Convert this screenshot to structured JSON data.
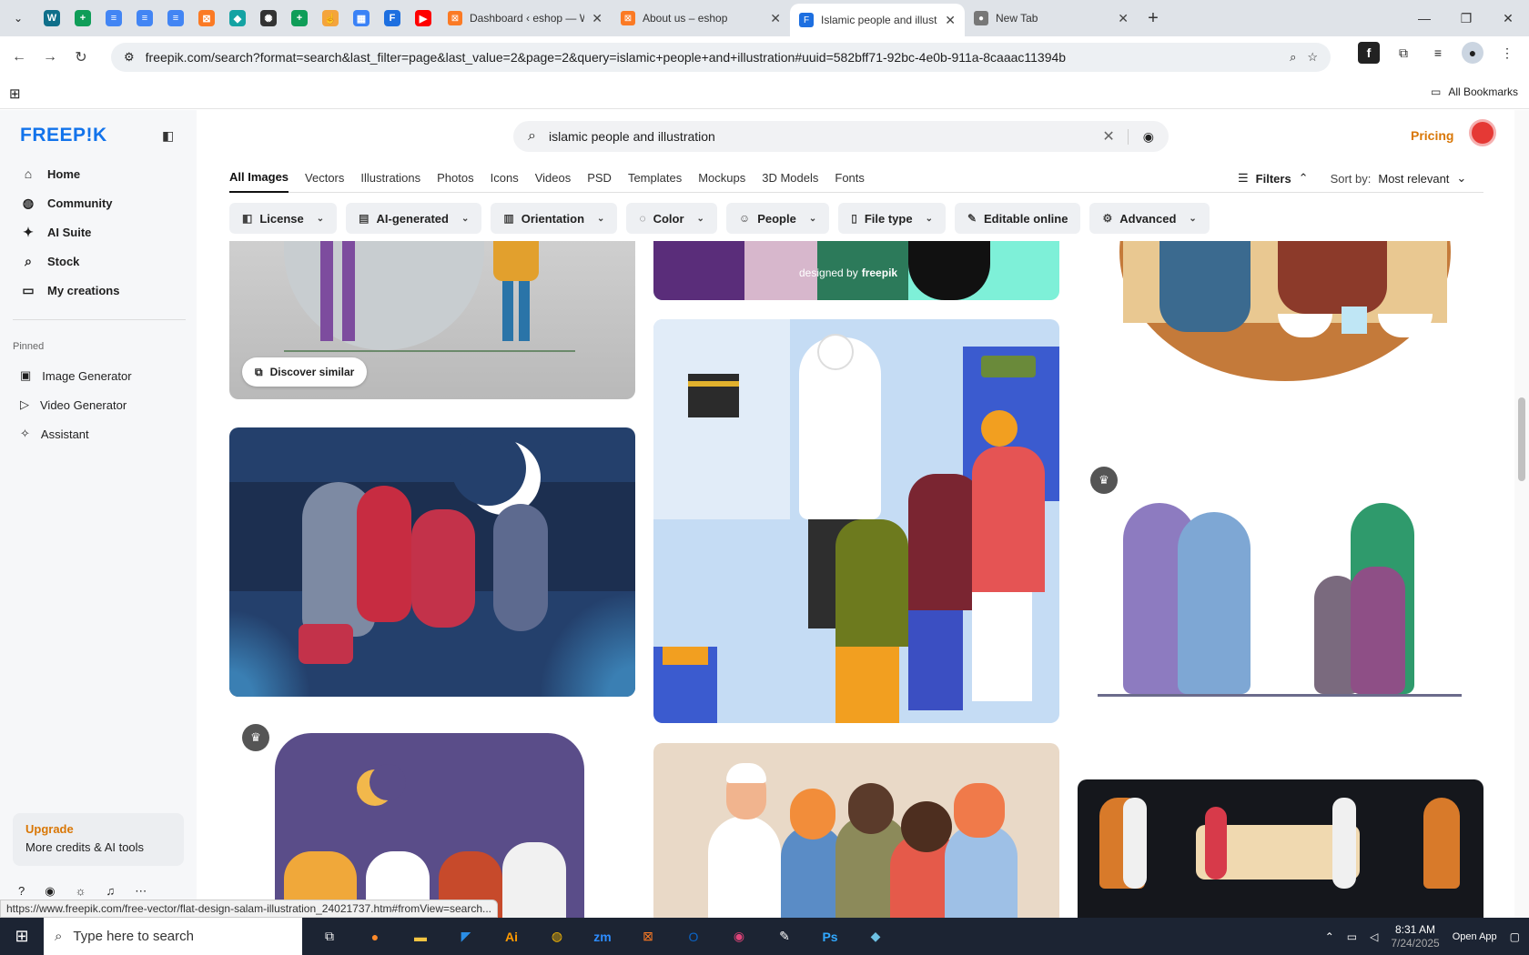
{
  "browser": {
    "pinned_tabs": [
      {
        "name": "wordpress-icon",
        "color": "#0f6f8a",
        "glyph": "W"
      },
      {
        "name": "sheets-icon",
        "color": "#0f9d58",
        "glyph": "+"
      },
      {
        "name": "docs-icon",
        "color": "#4285f4",
        "glyph": "≡"
      },
      {
        "name": "docs-icon",
        "color": "#4285f4",
        "glyph": "≡"
      },
      {
        "name": "docs-icon",
        "color": "#4285f4",
        "glyph": "≡"
      },
      {
        "name": "xampp-icon",
        "color": "#fb7a24",
        "glyph": "⊠"
      },
      {
        "name": "app-icon",
        "color": "#14a3a3",
        "glyph": "◆"
      },
      {
        "name": "chatgpt-icon",
        "color": "#333333",
        "glyph": "✺"
      },
      {
        "name": "sheets-icon",
        "color": "#0f9d58",
        "glyph": "+"
      },
      {
        "name": "hand-icon",
        "color": "#f4a43c",
        "glyph": "☝"
      },
      {
        "name": "qr-icon",
        "color": "#3b82f6",
        "glyph": "▦"
      },
      {
        "name": "forms-icon",
        "color": "#1d6fe0",
        "glyph": "F"
      },
      {
        "name": "youtube-icon",
        "color": "#ff0000",
        "glyph": "▶"
      }
    ],
    "tabs": [
      {
        "title": "Dashboard ‹ eshop — Wo",
        "color": "#fb7a24",
        "glyph": "⊠",
        "active": false
      },
      {
        "title": "About us – eshop",
        "color": "#fb7a24",
        "glyph": "⊠",
        "active": false
      },
      {
        "title": "Islamic people and illustr",
        "color": "#1d6fe0",
        "glyph": "F",
        "active": true
      },
      {
        "title": "New Tab",
        "color": "#777777",
        "glyph": "●",
        "active": false
      }
    ],
    "url": "freepik.com/search?format=search&last_filter=page&last_value=2&page=2&query=islamic+people+and+illustration#uuid=582bff71-92bc-4e0b-911a-8caaac11394b",
    "all_bookmarks": "All Bookmarks",
    "status_url": "https://www.freepik.com/free-vector/flat-design-salam-illustration_24021737.htm#fromView=search..."
  },
  "sidebar": {
    "logo": "FREEP!K",
    "nav": [
      {
        "label": "Home",
        "icon": "home-icon",
        "glyph": "⌂"
      },
      {
        "label": "Community",
        "icon": "globe-icon",
        "glyph": "◍"
      },
      {
        "label": "AI Suite",
        "icon": "sparkle-icon",
        "glyph": "✦"
      },
      {
        "label": "Stock",
        "icon": "search-icon",
        "glyph": "⌕"
      },
      {
        "label": "My creations",
        "icon": "folder-icon",
        "glyph": "▭"
      }
    ],
    "pinned_label": "Pinned",
    "pinned": [
      {
        "label": "Image Generator",
        "icon": "image-icon",
        "glyph": "▣"
      },
      {
        "label": "Video Generator",
        "icon": "video-icon",
        "glyph": "▷"
      },
      {
        "label": "Assistant",
        "icon": "assistant-icon",
        "glyph": "✧"
      }
    ],
    "upgrade": {
      "title": "Upgrade",
      "subtitle": "More credits & AI tools"
    }
  },
  "header": {
    "search_value": "islamic people and illustration",
    "pricing": "Pricing"
  },
  "content_tabs": [
    "All Images",
    "Vectors",
    "Illustrations",
    "Photos",
    "Icons",
    "Videos",
    "PSD",
    "Templates",
    "Mockups",
    "3D Models",
    "Fonts"
  ],
  "sort": {
    "filters_label": "Filters",
    "sort_label": "Sort by:",
    "sort_value": "Most relevant"
  },
  "filters": [
    {
      "label": "License",
      "glyph": "◧"
    },
    {
      "label": "AI-generated",
      "glyph": "▤"
    },
    {
      "label": "Orientation",
      "glyph": "▥"
    },
    {
      "label": "Color",
      "glyph": "◌"
    },
    {
      "label": "People",
      "glyph": "☺"
    },
    {
      "label": "File type",
      "glyph": "▯"
    },
    {
      "label": "Editable online",
      "glyph": "✎"
    },
    {
      "label": "Advanced",
      "glyph": "⚙"
    }
  ],
  "gallery": {
    "discover_similar": "Discover similar",
    "designed_by": "designed by",
    "brand": "freepik"
  },
  "taskbar": {
    "search_placeholder": "Type here to search",
    "time": "8:31 AM",
    "date": "7/24/2025",
    "open_app": "Open App"
  }
}
